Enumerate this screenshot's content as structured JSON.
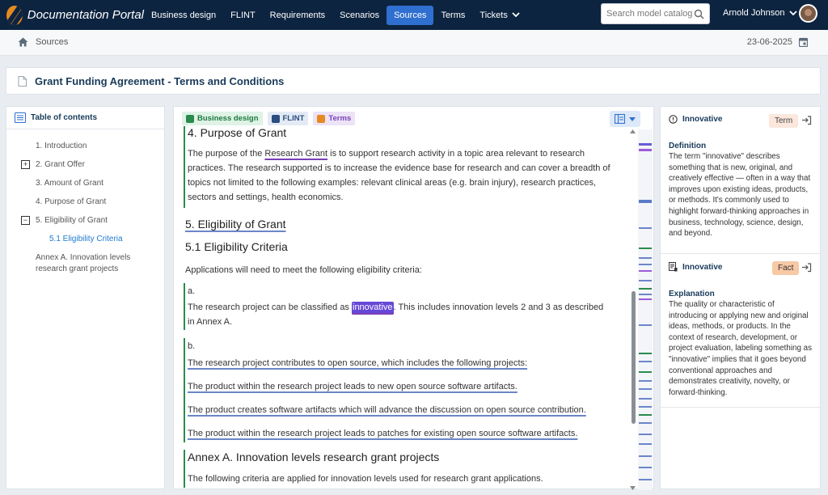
{
  "header": {
    "app_title": "Documentation Portal",
    "nav": [
      "Business design",
      "FLINT",
      "Requirements",
      "Scenarios",
      "Sources",
      "Terms",
      "Tickets"
    ],
    "active_nav": "Sources",
    "search_placeholder": "Search model catalog",
    "user_name": "Arnold Johnson"
  },
  "breadcrumb": {
    "current": "Sources",
    "date": "23-06-2025"
  },
  "document": {
    "title": "Grant Funding Agreement - Terms and Conditions"
  },
  "toc": {
    "heading": "Table of contents",
    "items": [
      "1. Introduction",
      "2. Grant Offer",
      "3. Amount of Grant",
      "4. Purpose of Grant",
      "5. Eligibility of Grant",
      "5.1 Eligibility Criteria",
      "Annex A. Innovation levels research grant projects"
    ]
  },
  "tags": [
    "Business design",
    "FLINT",
    "Terms"
  ],
  "content": {
    "h_purpose": "4. Purpose of Grant",
    "p_purpose_1": "The purpose of the ",
    "p_purpose_link": "Research Grant",
    "p_purpose_2": " is to support research activity in a topic area relevant to research practices. The research supported is to increase the evidence base for research and can cover a breadth of topics not limited to the following examples: relevant clinical areas (e.g. brain injury), research practices, sectors and settings, health economics.",
    "h_eligibility": "5. Eligibility of Grant",
    "h_criteria": "5.1 Eligibility Criteria",
    "p_apps": "Applications will need to meet the following eligibility criteria:",
    "a_label": "a.",
    "a_text_1": "The research project can be classified as ",
    "a_highlight": "innovative",
    "a_text_2": ". This includes innovation levels 2 and 3 as described in Annex A.",
    "b_label": "b.",
    "b_lines": [
      "The research project contributes to open source, which includes the following projects:",
      "The product within the research project leads to new open source software artifacts.",
      "The product creates software artifacts which will advance the discussion on open source contribution.",
      "The product within the research project leads to patches for existing open source software artifacts."
    ],
    "h_annex": "Annex A. Innovation levels research grant projects",
    "p_annex": "The following criteria are applied for innovation levels used for research grant applications."
  },
  "sidebar": {
    "term": {
      "name": "Innovative",
      "badge": "Term",
      "label": "Definition",
      "text": "The term \"innovative\" describes something that is new, original, and creatively effective — often in a way that improves upon existing ideas, products, or methods. It's commonly used to highlight forward-thinking approaches in business, technology, science, design, and beyond."
    },
    "fact": {
      "name": "Innovative",
      "badge": "Fact",
      "label": "Explanation",
      "text": "The quality or characteristic of introducing or applying new and original ideas, methods, or products. In the context of research, development, or project evaluation, labeling something as \"innovative\" implies that it goes beyond conventional approaches and demonstrates creativity, novelty, or forward-thinking."
    }
  },
  "colors": {
    "nav_bg": "#0d2440",
    "accent": "#2f6fcf",
    "green_bar": "#2a8b4d",
    "term_purple": "#7b3fb8",
    "flint_blue": "#6b86c9"
  }
}
